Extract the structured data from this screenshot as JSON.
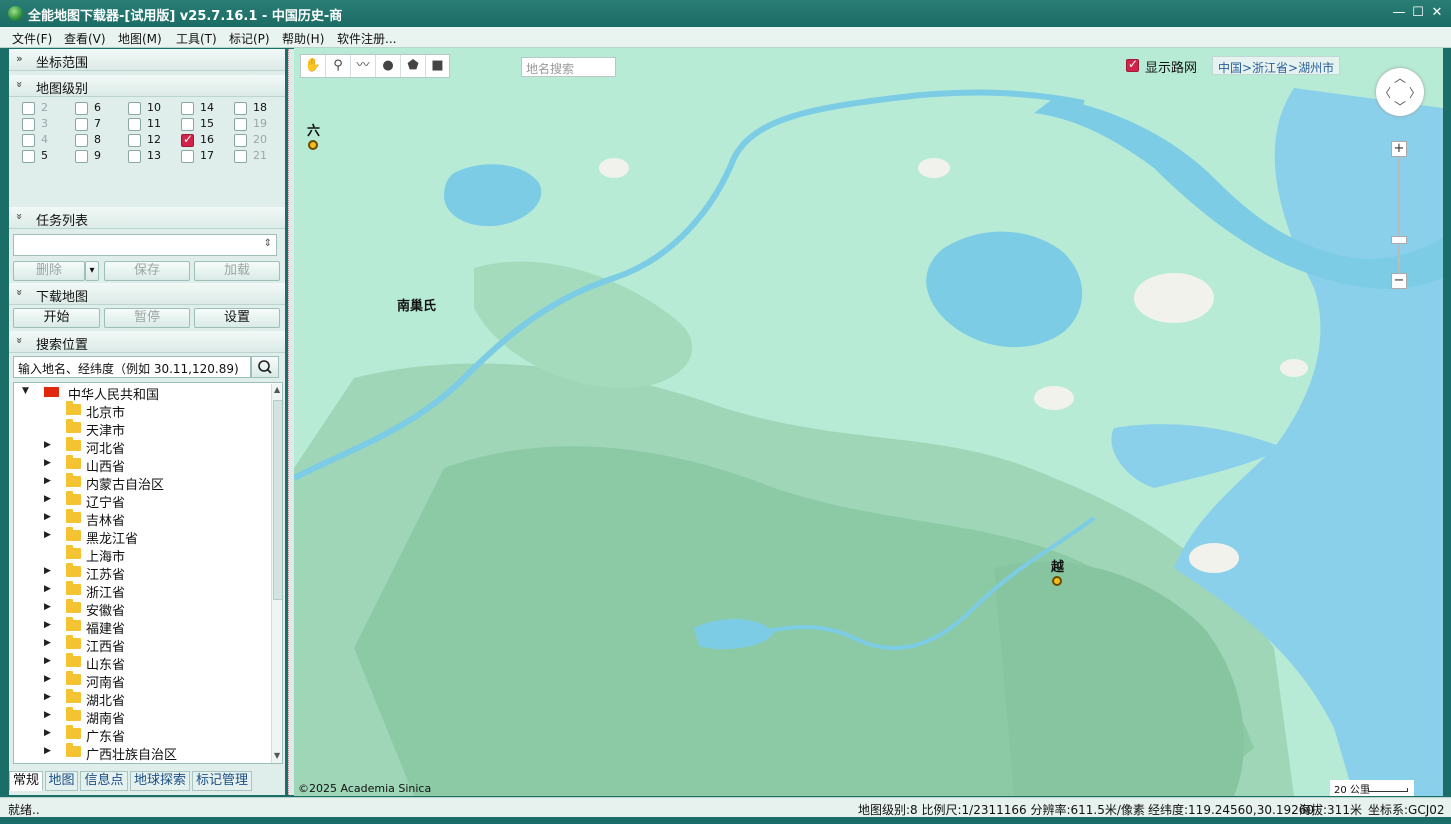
{
  "window": {
    "title": "全能地图下载器-[试用版] v25.7.16.1 - 中国历史-商",
    "min_glyph": "—",
    "max_glyph": "☐",
    "close_glyph": "✕"
  },
  "menu": [
    "文件(F)",
    "查看(V)",
    "地图(M)",
    "工具(T)",
    "标记(P)",
    "帮助(H)",
    "软件注册..."
  ],
  "sections": {
    "coord_range": "坐标范围",
    "map_level": "地图级别",
    "task_list": "任务列表",
    "download_map": "下载地图",
    "search_location": "搜索位置",
    "collapse_glyph": "»",
    "expand_glyph": "»"
  },
  "levels": [
    {
      "n": "2",
      "checked": false,
      "enabled": false
    },
    {
      "n": "3",
      "checked": false,
      "enabled": false
    },
    {
      "n": "4",
      "checked": false,
      "enabled": false
    },
    {
      "n": "5",
      "checked": false,
      "enabled": true
    },
    {
      "n": "6",
      "checked": false,
      "enabled": true
    },
    {
      "n": "7",
      "checked": false,
      "enabled": true
    },
    {
      "n": "8",
      "checked": false,
      "enabled": true
    },
    {
      "n": "9",
      "checked": false,
      "enabled": true
    },
    {
      "n": "10",
      "checked": false,
      "enabled": true
    },
    {
      "n": "11",
      "checked": false,
      "enabled": true
    },
    {
      "n": "12",
      "checked": false,
      "enabled": true
    },
    {
      "n": "13",
      "checked": false,
      "enabled": true
    },
    {
      "n": "14",
      "checked": false,
      "enabled": true
    },
    {
      "n": "15",
      "checked": false,
      "enabled": true
    },
    {
      "n": "16",
      "checked": true,
      "enabled": true
    },
    {
      "n": "17",
      "checked": false,
      "enabled": true
    },
    {
      "n": "18",
      "checked": false,
      "enabled": true
    },
    {
      "n": "19",
      "checked": false,
      "enabled": false
    },
    {
      "n": "20",
      "checked": false,
      "enabled": false
    },
    {
      "n": "21",
      "checked": false,
      "enabled": false
    }
  ],
  "task_buttons": {
    "delete": "删除",
    "save": "保存",
    "load": "加载",
    "dropdown_glyph": "▾",
    "spinner_glyph": "⇕"
  },
  "download_buttons": {
    "start": "开始",
    "pause": "暂停",
    "settings": "设置"
  },
  "search": {
    "placeholder": "输入地名、经纬度（例如 30.11,120.89)",
    "icon": "search-icon"
  },
  "tree": {
    "root": "中华人民共和国",
    "expand_glyph": "▶",
    "collapse_glyph": "▼",
    "items": [
      {
        "label": "北京市",
        "expandable": false
      },
      {
        "label": "天津市",
        "expandable": false
      },
      {
        "label": "河北省",
        "expandable": true
      },
      {
        "label": "山西省",
        "expandable": true
      },
      {
        "label": "内蒙古自治区",
        "expandable": true
      },
      {
        "label": "辽宁省",
        "expandable": true
      },
      {
        "label": "吉林省",
        "expandable": true
      },
      {
        "label": "黑龙江省",
        "expandable": true
      },
      {
        "label": "上海市",
        "expandable": false
      },
      {
        "label": "江苏省",
        "expandable": true
      },
      {
        "label": "浙江省",
        "expandable": true
      },
      {
        "label": "安徽省",
        "expandable": true
      },
      {
        "label": "福建省",
        "expandable": true
      },
      {
        "label": "江西省",
        "expandable": true
      },
      {
        "label": "山东省",
        "expandable": true
      },
      {
        "label": "河南省",
        "expandable": true
      },
      {
        "label": "湖北省",
        "expandable": true
      },
      {
        "label": "湖南省",
        "expandable": true
      },
      {
        "label": "广东省",
        "expandable": true
      },
      {
        "label": "广西壮族自治区",
        "expandable": true
      }
    ]
  },
  "bottom_tabs": [
    {
      "label": "常规",
      "active": true
    },
    {
      "label": "地图",
      "active": false
    },
    {
      "label": "信息点",
      "active": false
    },
    {
      "label": "地球探索",
      "active": false
    },
    {
      "label": "标记管理",
      "active": false
    }
  ],
  "map": {
    "search_placeholder": "地名搜索",
    "show_road_network": "显示路网",
    "road_network_checked": true,
    "breadcrumb": "中国>浙江省>湖州市",
    "labels": {
      "liu": "六",
      "nanchao": "南巢氏",
      "yue": "越"
    },
    "copyright": "©2025 Academia Sinica",
    "scale": "20 公里",
    "zoom_in": "+",
    "zoom_out": "−",
    "nav_up": "︿",
    "nav_down": "﹀",
    "nav_left": "〈",
    "nav_right": "〉",
    "tools": [
      "hand-icon",
      "pin-icon",
      "polyline-icon",
      "circle-icon",
      "polygon-icon",
      "rectangle-icon"
    ],
    "tool_glyphs": [
      "✋",
      "⚲",
      "〰",
      "●",
      "⬟",
      "■"
    ],
    "colors": {
      "land": "#b7ebd6",
      "water": "#7ccce6",
      "sea": "#8ad0ea",
      "hills": "#8fc9a8",
      "urban": "#f2f2ec"
    }
  },
  "status": {
    "ready": "就绪..",
    "info": "地图级别:8 比例尺:1/2311166 分辨率:611.5米/像素",
    "coords": "经纬度:119.24560,30.19260",
    "altitude": "海拔:311米",
    "coord_system": "坐标系:GCJ02"
  }
}
